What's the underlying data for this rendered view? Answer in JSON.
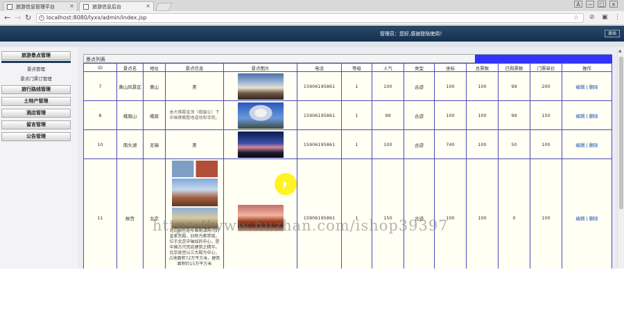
{
  "browser": {
    "tabs": [
      {
        "label": "旅游信息管理平台",
        "close": "×"
      },
      {
        "label": "旅游信息后台",
        "close": "×"
      }
    ],
    "url": "localhost:8080/lyxx/admin/index.jsp",
    "window_controls": [
      "A",
      "—",
      "□",
      "×"
    ]
  },
  "header": {
    "welcome": "管理员：您好,感谢登陆使用！",
    "logout_label": "退出"
  },
  "sidebar": {
    "menus": [
      {
        "label": "旅游景点管理",
        "subs": [
          "景点管理",
          "景点门票订管理"
        ]
      },
      {
        "label": "旅行路线管理",
        "subs": []
      },
      {
        "label": "土特产管理",
        "subs": []
      },
      {
        "label": "酒店管理",
        "subs": []
      },
      {
        "label": "留言管理",
        "subs": []
      },
      {
        "label": "公告管理",
        "subs": []
      }
    ]
  },
  "table": {
    "caption": "景点列表",
    "columns": [
      "ID",
      "景点名",
      "地址",
      "景点信息",
      "景点图片",
      "电话",
      "等级",
      "人气",
      "类型",
      "坐标",
      "总票数",
      "已购票数",
      "门票单价",
      "操作"
    ],
    "rows": [
      {
        "id": "7",
        "name": "黄山风景区",
        "addr": "黄山",
        "info": "美",
        "phone": "15906195861",
        "level": "1",
        "pop": "100",
        "type": "古迹",
        "coord": "100",
        "total": "100",
        "sold": "99",
        "price": "200",
        "edit": "编辑",
        "sep": "|",
        "del": "删除"
      },
      {
        "id": "8",
        "name": "峨眉山",
        "addr": "峨眉",
        "info": "由大佛殿金顶（峨眉公）下中国佛教胜地道场和寺院。",
        "phone": "15906195861",
        "level": "1",
        "pop": "99",
        "type": "古迹",
        "coord": "100",
        "total": "100",
        "sold": "99",
        "price": "150",
        "edit": "编辑",
        "sep": "|",
        "del": "删除"
      },
      {
        "id": "10",
        "name": "南头湖",
        "addr": "无锡",
        "info": "美",
        "phone": "15906195861",
        "level": "1",
        "pop": "100",
        "type": "古迹",
        "coord": "740",
        "total": "100",
        "sold": "50",
        "price": "100",
        "edit": "编辑",
        "sep": "|",
        "del": "删除"
      },
      {
        "id": "11",
        "name": "故宫",
        "addr": "北京",
        "info": "北京故宫是中国明清两代的皇家宫殿，旧称为紫禁城，位于北京中轴线的中心，是中国古代宫廷建筑之精华。北京故宫以三大殿为中心，占地面积72万平方米，建筑面积约15万平方米",
        "phone": "15906195861",
        "level": "1",
        "pop": "150",
        "type": "古迹",
        "coord": "100",
        "total": "100",
        "sold": "0",
        "price": "100",
        "edit": "编辑",
        "sep": "|",
        "del": "删除"
      }
    ]
  },
  "watermark": "https://www.huzhan.com/ishop39397",
  "colors": {
    "header": "#143050",
    "table_border": "#4a4ab8",
    "caption_blue": "#3333ff",
    "cursor_highlight": "#ffee00"
  }
}
